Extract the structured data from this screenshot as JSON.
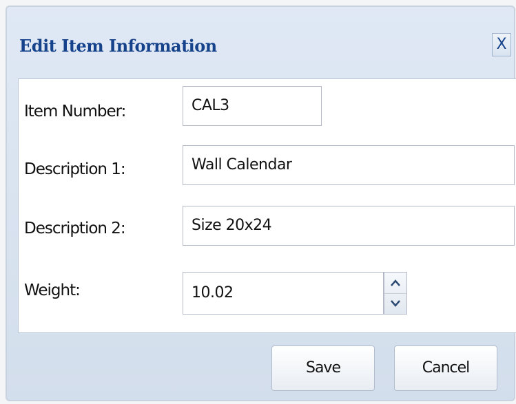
{
  "dialog": {
    "title": "Edit Item Information",
    "close_label": "X"
  },
  "fields": {
    "item_number": {
      "label": "Item Number:",
      "value": "CAL3"
    },
    "description1": {
      "label": "Description 1:",
      "value": "Wall Calendar"
    },
    "description2": {
      "label": "Description 2:",
      "value": "Size 20x24"
    },
    "weight": {
      "label": "Weight:",
      "value": "10.02"
    }
  },
  "spinner": {
    "up_icon": "chevron-up-icon",
    "down_icon": "chevron-down-icon"
  },
  "buttons": {
    "save_label": "Save",
    "cancel_label": "Cancel"
  },
  "colors": {
    "title_text": "#15428b",
    "dialog_background": "#dfe8f4",
    "form_background": "#ffffff"
  }
}
